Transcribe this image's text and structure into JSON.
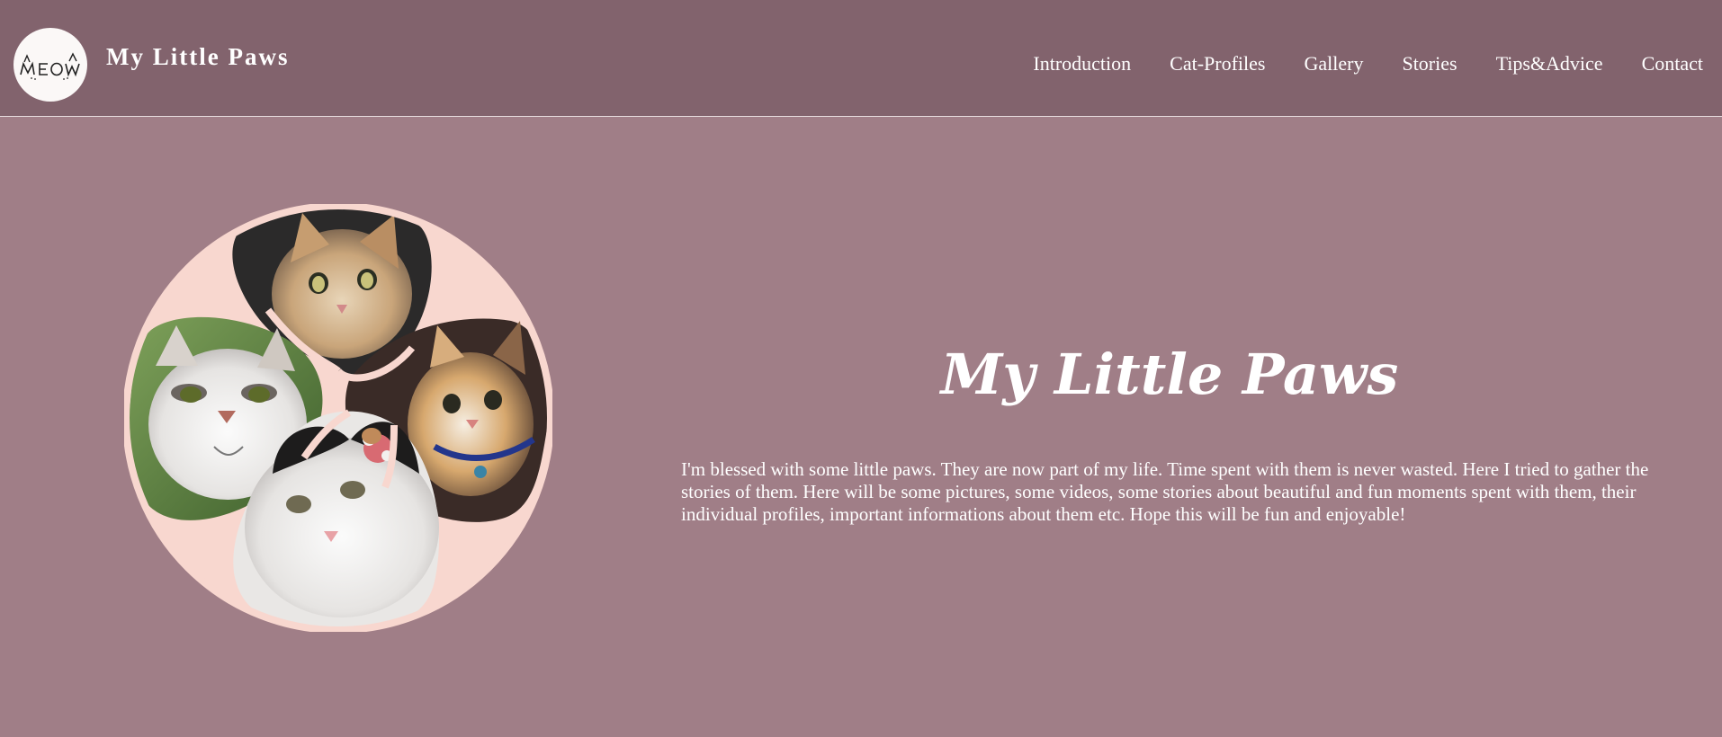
{
  "header": {
    "logo_text": "MEOW",
    "brand_name": "My Little Paws",
    "nav": [
      {
        "label": "Introduction"
      },
      {
        "label": "Cat-Profiles"
      },
      {
        "label": "Gallery"
      },
      {
        "label": "Stories"
      },
      {
        "label": "Tips&Advice"
      },
      {
        "label": "Contact"
      }
    ]
  },
  "hero": {
    "title": "My Little Paws",
    "intro": "I'm blessed with some little paws. They are now part of my life. Time spent with them is never wasted. Here I tried to gather the stories of them. Here will be some pictures, some videos, some stories about beautiful and fun moments spent with them, their individual profiles, important informations about them etc. Hope this will be fun and enjoyable!"
  },
  "colors": {
    "header_bg": "#82636d",
    "page_bg": "#a07e87",
    "collage_bg": "#f8d7cf",
    "text": "#ffffff"
  }
}
